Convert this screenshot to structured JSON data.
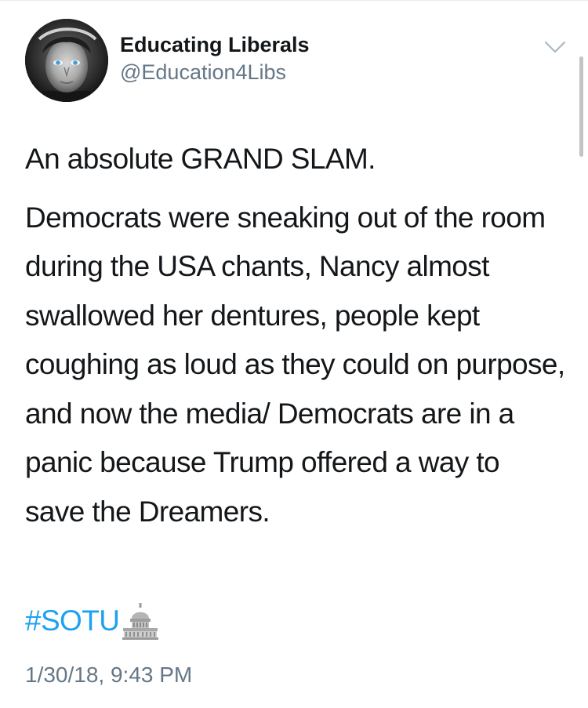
{
  "tweet": {
    "author": {
      "display_name": "Educating Liberals",
      "handle": "@Education4Libs",
      "avatar_icon": "profile-photo"
    },
    "menu_icon": "chevron-down-icon",
    "text_lead": "An absolute GRAND SLAM.",
    "text_body": "Democrats were sneaking out of the room during the USA chants, Nancy almost swallowed her dentures, people kept coughing as loud as they could on purpose, and now the media/ Democrats are in a panic because Trump offered a way to save the Dreamers.",
    "hashtag": "#SOTU",
    "hashtag_emoji": "capitol-building-icon",
    "timestamp": "1/30/18, 9:43 PM"
  },
  "colors": {
    "text": "#14171a",
    "secondary_text": "#657786",
    "link": "#1da1f2",
    "background": "#ffffff"
  }
}
